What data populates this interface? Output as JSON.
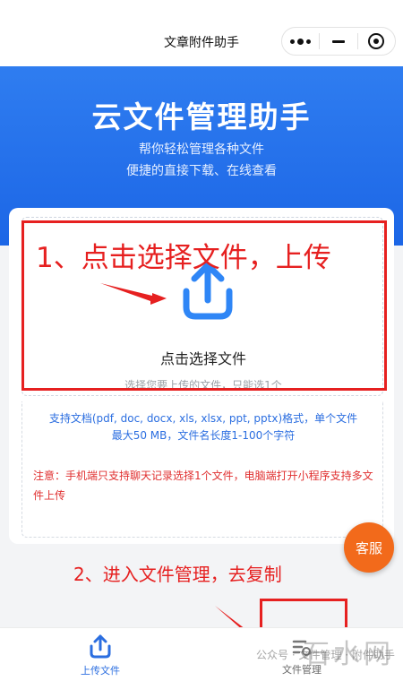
{
  "navbar": {
    "title": "文章附件助手",
    "capsule": {
      "menu_icon": "more-dots-icon",
      "minimize_icon": "minus-icon",
      "close_icon": "target-circle-icon"
    }
  },
  "hero": {
    "title": "云文件管理助手",
    "subtitle_line1": "帮你轻松管理各种文件",
    "subtitle_line2": "便捷的直接下载、在线查看",
    "background_color": "#1c66e6"
  },
  "upload": {
    "icon": "upload-icon",
    "label": "点击选择文件",
    "hint": "选择您要上传的文件，只能选1个"
  },
  "info": {
    "formats_line1": "支持文档(pdf, doc, docx, xls, xlsx, ppt, pptx)格式，单个文件",
    "formats_line2": "最大50 MB，文件名长度1-100个字符",
    "notice": "注意：手机端只支持聊天记录选择1个文件，电脑端打开小程序支持多文件上传",
    "notice_color": "#e03030",
    "formats_color": "#2b6ee0"
  },
  "annotations": {
    "step1": "1、点击选择文件，上传",
    "step2": "2、进入文件管理，去复制",
    "color": "#e62020"
  },
  "customer_service": {
    "label": "客服",
    "color": "#f26a1b"
  },
  "tabbar": {
    "upload_label": "上传文件",
    "upload_icon": "upload-icon",
    "manage_label": "文件管理",
    "manage_icon": "file-manage-icon"
  },
  "watermark": {
    "text": "公众号 · 文件管理 · 附件助手",
    "logo": "石水网"
  }
}
